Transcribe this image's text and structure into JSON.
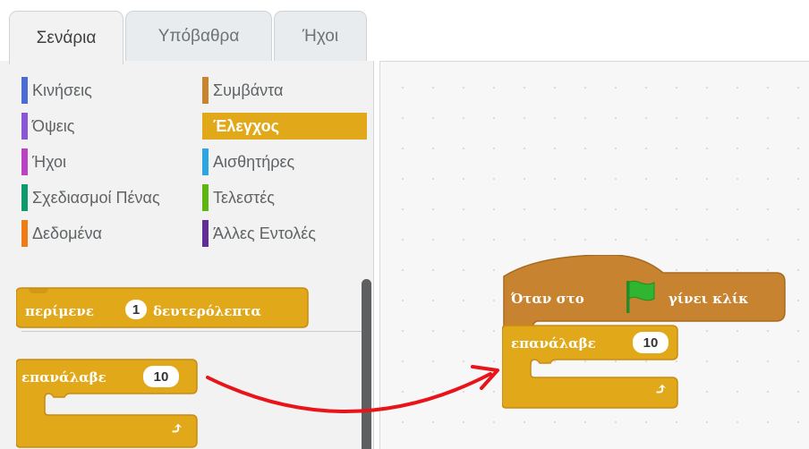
{
  "tabs": [
    {
      "label": "Σενάρια",
      "active": true
    },
    {
      "label": "Υπόβαθρα",
      "active": false
    },
    {
      "label": "Ήχοι",
      "active": false
    }
  ],
  "categories": [
    {
      "label": "Κινήσεις",
      "color": "#4a6cd4"
    },
    {
      "label": "Όψεις",
      "color": "#8a55d7"
    },
    {
      "label": "Ήχοι",
      "color": "#bb42c3"
    },
    {
      "label": "Σχεδιασμοί Πένας",
      "color": "#0e9a6c"
    },
    {
      "label": "Δεδομένα",
      "color": "#ee7d16"
    },
    {
      "label": "Συμβάντα",
      "color": "#c88330"
    },
    {
      "label": "Έλεγχος",
      "color": "#e1a91a",
      "selected": true
    },
    {
      "label": "Αισθητήρες",
      "color": "#2ca5e2"
    },
    {
      "label": "Τελεστές",
      "color": "#5cb712"
    },
    {
      "label": "Άλλες Εντολές",
      "color": "#632d99"
    }
  ],
  "palette": {
    "wait_block": {
      "prefix": "περίμενε",
      "value": "1",
      "suffix": "δευτερόλεπτα"
    },
    "repeat_block": {
      "label": "επανάλαβε",
      "value": "10",
      "arrow": "⤴"
    }
  },
  "script": {
    "hat_block": {
      "prefix": "Όταν στο",
      "icon": "green-flag-icon",
      "suffix": "γίνει κλίκ"
    },
    "repeat_block": {
      "label": "επανάλαβε",
      "value": "10",
      "arrow": "⤴"
    }
  },
  "colors": {
    "control": "#e1a91a",
    "control_dark": "#c88a13",
    "events": "#c88330",
    "events_dark": "#a86a20",
    "arrow": "#e8141a",
    "flag": "#2fb52f"
  }
}
